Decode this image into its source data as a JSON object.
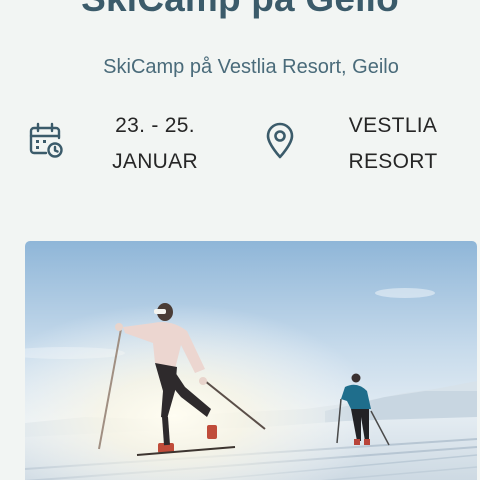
{
  "header": {
    "title": "SkiCamp på Geilo",
    "subtitle": "SkiCamp på Vestlia Resort, Geilo"
  },
  "event": {
    "date_line1": "23. - 25.",
    "date_line2": "JANUAR",
    "venue_line1": "VESTLIA",
    "venue_line2": "RESORT",
    "date_icon": "calendar-clock-icon",
    "venue_icon": "map-pin-icon"
  },
  "hero_image": {
    "subject": "two cross-country skiers in snowy sunlit mountains"
  },
  "colors": {
    "accent": "#3b5b6a",
    "background": "#f2f5f3",
    "text": "#262626"
  }
}
